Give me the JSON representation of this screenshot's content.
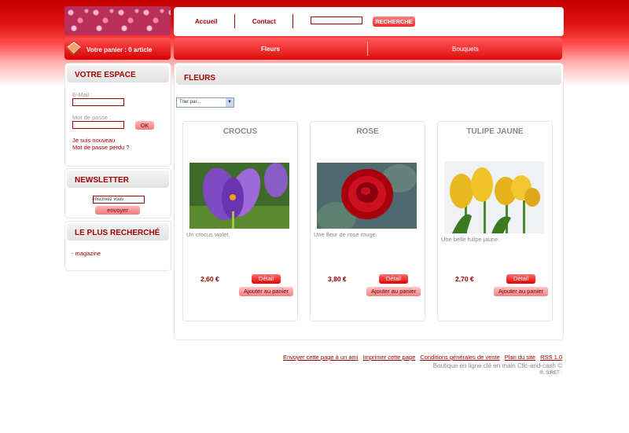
{
  "header": {
    "cart_text": "Votre panier : 0 article",
    "nav": [
      "Accueil",
      "Contact"
    ],
    "search_button": "RECHERCHE",
    "search_value": "",
    "categories": [
      "Fleurs",
      "Bouquets"
    ]
  },
  "sidebar": {
    "espace": {
      "title": "VOTRE ESPACE",
      "email_label": "E-Mail :",
      "password_label": "Mot de passe :",
      "ok_button": "OK",
      "new_link": "Je suis nouveau",
      "lost_link": "Mot de passe perdu ?"
    },
    "newsletter": {
      "title": "NEWSLETTER",
      "input_value": "Inscrivez vous",
      "button": "envoyer"
    },
    "popular": {
      "title": "LE PLUS RECHERCHÉ",
      "items": [
        "- magazine"
      ]
    }
  },
  "main": {
    "title": "FLEURS",
    "sort_label": "Trier par...",
    "products": [
      {
        "name": "CROCUS",
        "description": "Un crocus violet.",
        "price": "2,60 €",
        "detail": "Détail",
        "add": "Ajouter au panier",
        "image": "crocus-photo"
      },
      {
        "name": "ROSE",
        "description": "Une fleur de rose rouge.",
        "price": "3,80 €",
        "detail": "Détail",
        "add": "Ajouter au panier",
        "image": "rose-photo"
      },
      {
        "name": "TULIPE JAUNE",
        "description": "Une belle tulipe jaune.",
        "price": "2,70 €",
        "detail": "Détail",
        "add": "Ajouter au panier",
        "image": "tulip-photo"
      }
    ]
  },
  "footer": {
    "links": [
      "Envoyer cette page à un ami",
      "Imprimer cette page",
      "Conditions générales de vente",
      "Plan du site",
      "RSS 1.0"
    ],
    "line2": "Boutique en ligne clé en main Clic-and-cash ©",
    "line3": "®, SIRET :"
  },
  "colors": {
    "accent": "#a00000",
    "header_red": "#e00c0c"
  }
}
